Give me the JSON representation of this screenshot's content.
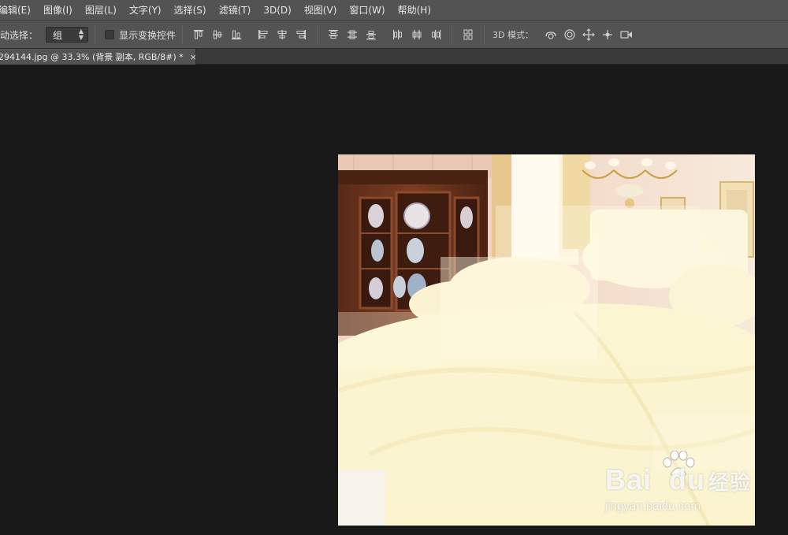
{
  "menubar": {
    "items": [
      "编辑(E)",
      "图像(I)",
      "图层(L)",
      "文字(Y)",
      "选择(S)",
      "滤镜(T)",
      "3D(D)",
      "视图(V)",
      "窗口(W)",
      "帮助(H)"
    ]
  },
  "options": {
    "auto_select_label": "动选择：",
    "select_value": "组",
    "show_transform_label": "显示变换控件",
    "mode_3d_label": "3D 模式："
  },
  "tab": {
    "title": "294144.jpg @ 33.3% (背景 副本, RGB/8#) *",
    "close": "×"
  },
  "watermark": {
    "brand": "Bai",
    "brand2": "du",
    "cn": "经验",
    "url": "jingyan.baidu.com"
  },
  "colors": {
    "menubar_bg": "#535353",
    "workspace_bg": "#191919",
    "canvas_bg": "#fbf6d8"
  }
}
